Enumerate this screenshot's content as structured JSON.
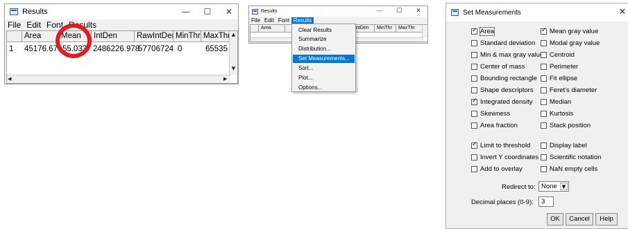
{
  "window1": {
    "title": "Results",
    "controls": {
      "minimize": "—",
      "maximize": "☐",
      "close": "✕"
    },
    "menu": [
      "File",
      "Edit",
      "Font",
      "Results"
    ],
    "table": {
      "columns": [
        "",
        "Area",
        "Mean",
        "IntDen",
        "RawIntDen",
        "MinThr",
        "MaxThr"
      ],
      "rows": [
        [
          "1",
          "45176.676",
          "55.033",
          "2486226.978",
          "57706724",
          "0",
          "65535"
        ]
      ]
    },
    "scroll": {
      "up": "▲",
      "down": "▼",
      "left": "◀",
      "right": "▶"
    }
  },
  "window2": {
    "title": "Results",
    "controls": {
      "minimize": "—",
      "maximize": "☐",
      "close": "✕"
    },
    "menu": [
      "File",
      "Edit",
      "Font",
      "Results"
    ],
    "active_menu": "Results",
    "table": {
      "columns": [
        "",
        "Area",
        "",
        "IntDen",
        "MinThr",
        "MaxThr"
      ]
    },
    "dropdown": [
      "Clear Results",
      "Summarize",
      "Distribution...",
      "Set Measurements...",
      "Sort...",
      "Plot...",
      "Options..."
    ],
    "highlighted_item": "Set Measurements..."
  },
  "dialog": {
    "title": "Set Measurements",
    "close": "✕",
    "measurements": [
      {
        "label": "Area",
        "checked": true
      },
      {
        "label": "Mean gray value",
        "checked": true
      },
      {
        "label": "Standard deviation",
        "checked": false
      },
      {
        "label": "Modal gray value",
        "checked": false
      },
      {
        "label": "Min & max gray value",
        "checked": false
      },
      {
        "label": "Centroid",
        "checked": false
      },
      {
        "label": "Center of mass",
        "checked": false
      },
      {
        "label": "Perimeter",
        "checked": false
      },
      {
        "label": "Bounding rectangle",
        "checked": false
      },
      {
        "label": "Fit ellipse",
        "checked": false
      },
      {
        "label": "Shape descriptors",
        "checked": false
      },
      {
        "label": "Feret's diameter",
        "checked": false
      },
      {
        "label": "Integrated density",
        "checked": true
      },
      {
        "label": "Median",
        "checked": false
      },
      {
        "label": "Skewness",
        "checked": false
      },
      {
        "label": "Kurtosis",
        "checked": false
      },
      {
        "label": "Area fraction",
        "checked": false
      },
      {
        "label": "Stack position",
        "checked": false
      }
    ],
    "options": [
      {
        "label": "Limit to threshold",
        "checked": true
      },
      {
        "label": "Display label",
        "checked": false
      },
      {
        "label": "Invert Y coordinates",
        "checked": false
      },
      {
        "label": "Scientific notation",
        "checked": false
      },
      {
        "label": "Add to overlay",
        "checked": false
      },
      {
        "label": "NaN empty cells",
        "checked": false
      }
    ],
    "redirect_label": "Redirect to:",
    "redirect_value": "None",
    "decimal_label": "Decimal places (0-9):",
    "decimal_value": "3",
    "buttons": {
      "ok": "OK",
      "cancel": "Cancel",
      "help": "Help"
    }
  },
  "colors": {
    "highlight": "#0078d7",
    "annotation": "#e31b23"
  }
}
